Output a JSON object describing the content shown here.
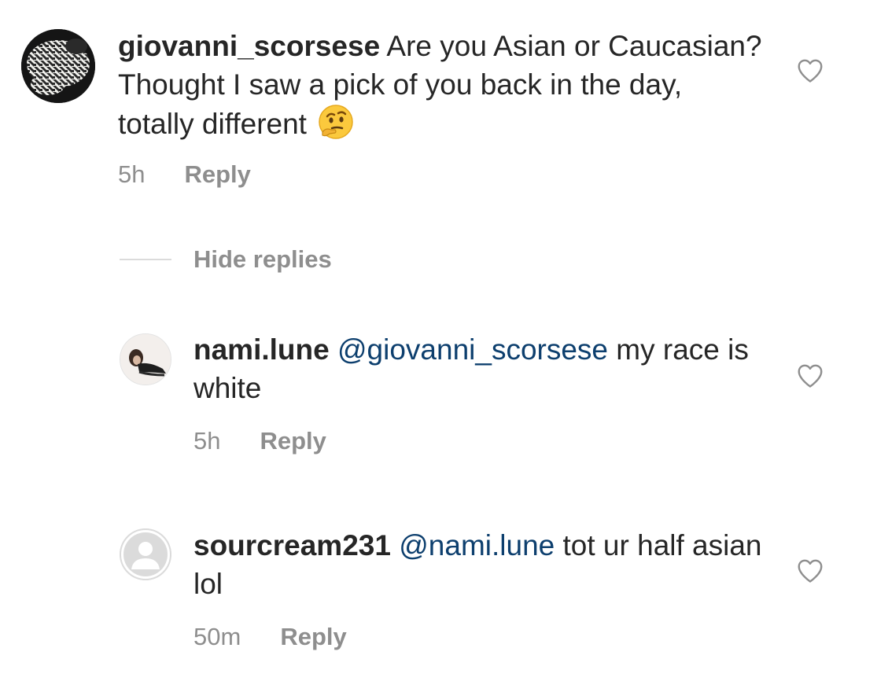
{
  "comments": [
    {
      "username": "giovanni_scorsese",
      "text": "Are you Asian or Caucasian? Thought I saw a pick of you back in the day, totally different",
      "emoji": "thinking-face-icon",
      "time": "5h",
      "reply_label": "Reply"
    },
    {
      "username": "nami.lune",
      "mention": "@giovanni_scorsese",
      "text": "my race is white",
      "time": "5h",
      "reply_label": "Reply"
    },
    {
      "username": "sourcream231",
      "mention": "@nami.lune",
      "text": "tot ur half asian lol",
      "time": "50m",
      "reply_label": "Reply"
    }
  ],
  "hide_replies_label": "Hide replies",
  "colors": {
    "text": "#262626",
    "meta": "#8e8e8e",
    "mention": "#0d3f6e",
    "divider": "#dbdbdb"
  }
}
